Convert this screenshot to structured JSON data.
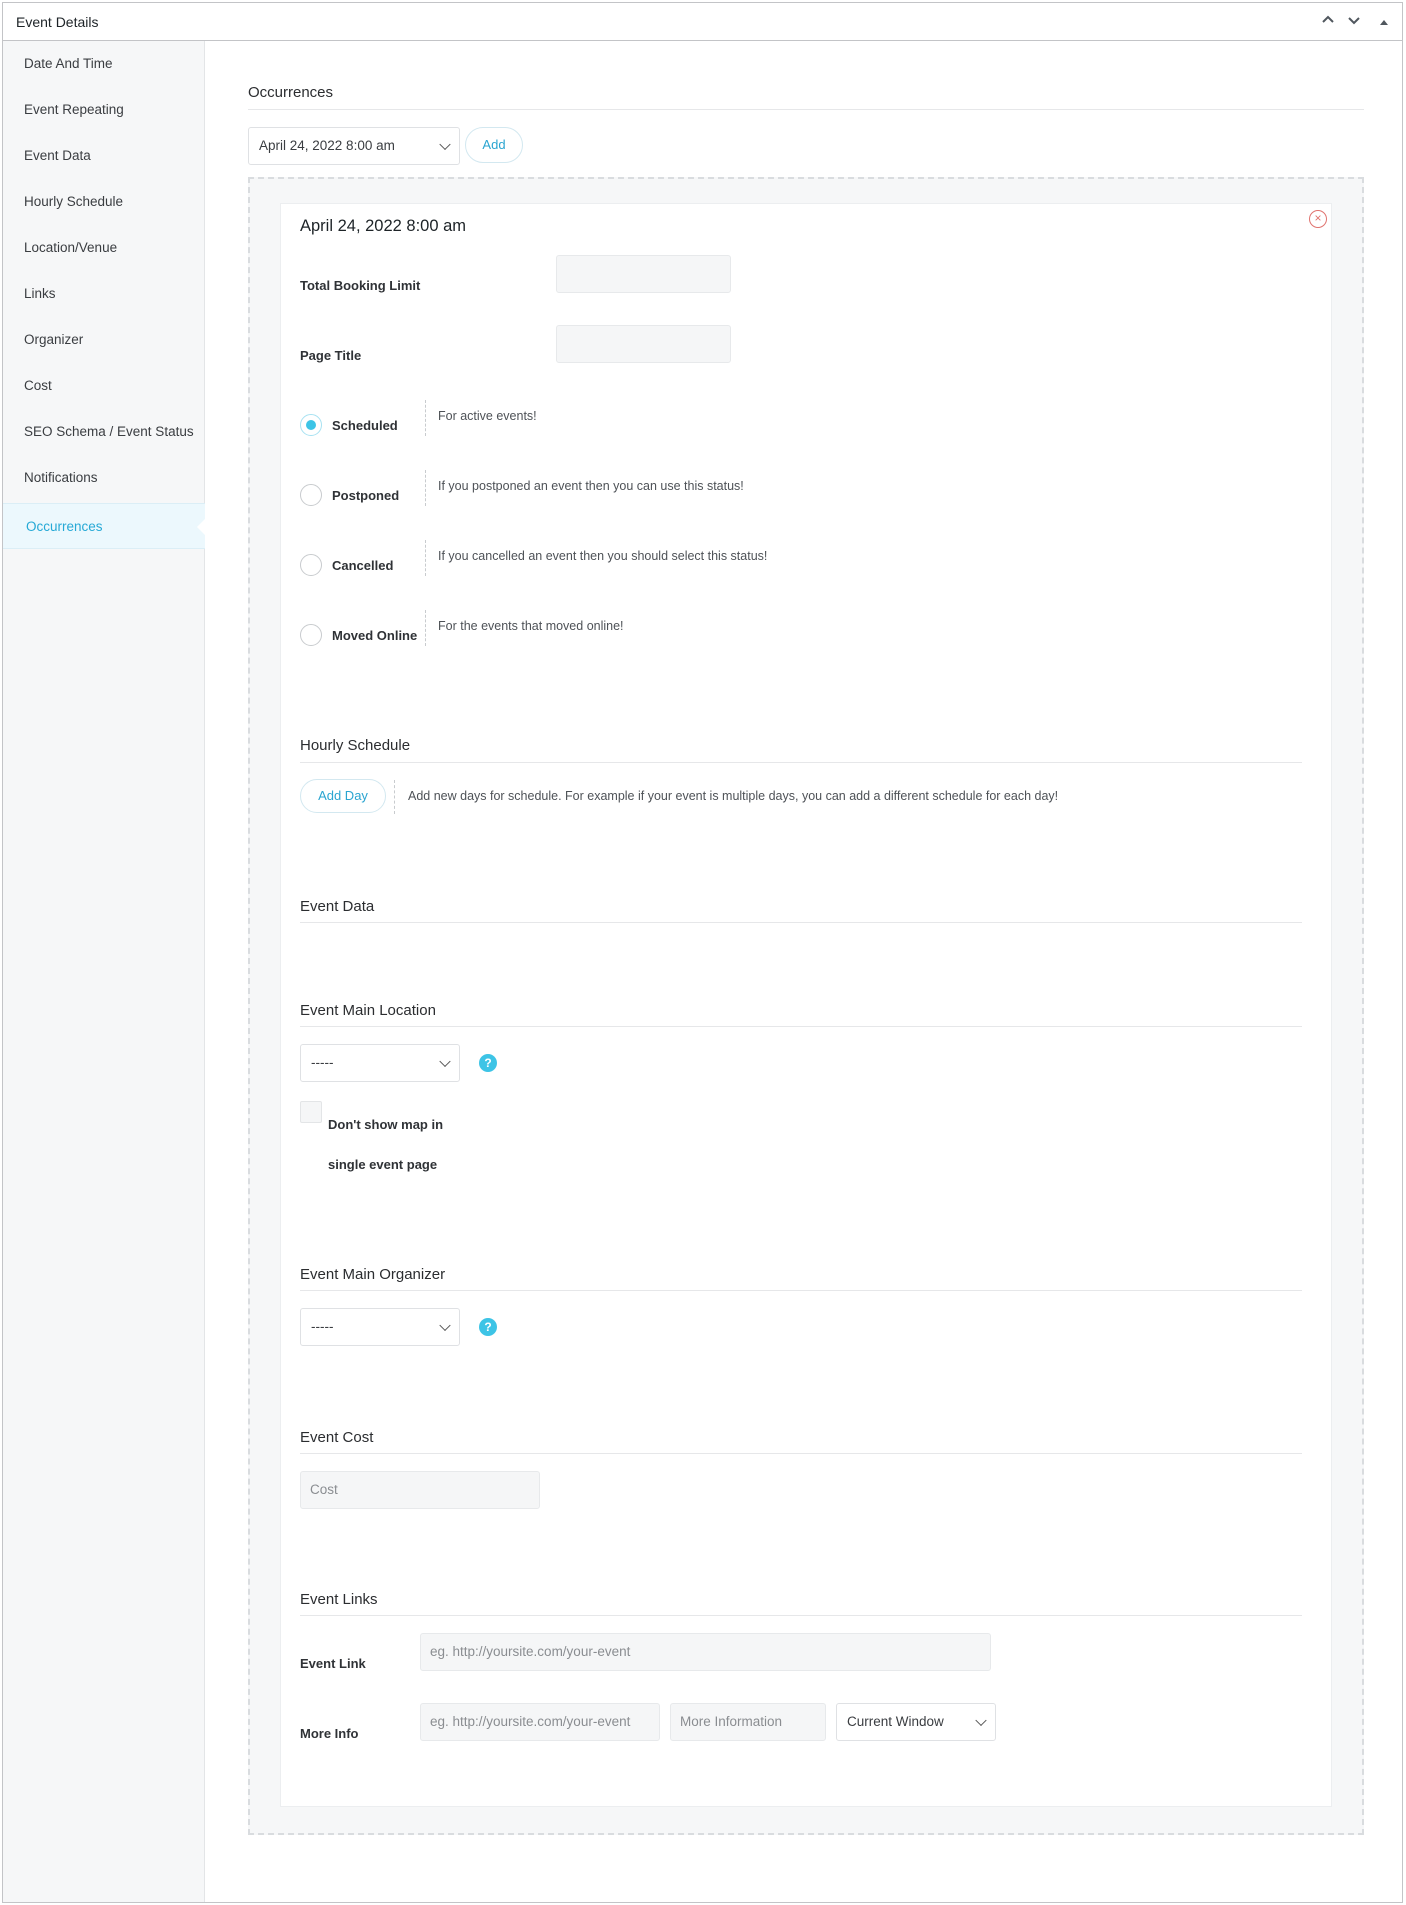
{
  "panel": {
    "title": "Event Details",
    "move_up_icon": "chevron-up-icon",
    "move_down_icon": "chevron-down-icon",
    "toggle_icon": "triangle-up-icon"
  },
  "sidebar": {
    "items": [
      {
        "label": "Date And Time"
      },
      {
        "label": "Event Repeating"
      },
      {
        "label": "Event Data"
      },
      {
        "label": "Hourly Schedule"
      },
      {
        "label": "Location/Venue"
      },
      {
        "label": "Links"
      },
      {
        "label": "Organizer"
      },
      {
        "label": "Cost"
      },
      {
        "label": "SEO Schema / Event Status"
      },
      {
        "label": "Notifications"
      },
      {
        "label": "Occurrences",
        "active": true
      }
    ]
  },
  "occurrences": {
    "heading": "Occurrences",
    "selected_date": "April 24, 2022 8:00 am",
    "add_label": "Add"
  },
  "occurrence": {
    "title": "April 24, 2022 8:00 am",
    "remove_icon": "close-circle-icon",
    "total_booking_limit_label": "Total Booking Limit",
    "total_booking_limit_value": "",
    "page_title_label": "Page Title",
    "page_title_value": "",
    "statuses": [
      {
        "label": "Scheduled",
        "desc": "For active events!",
        "checked": true
      },
      {
        "label": "Postponed",
        "desc": "If you postponed an event then you can use this status!",
        "checked": false
      },
      {
        "label": "Cancelled",
        "desc": "If you cancelled an event then you should select this status!",
        "checked": false
      },
      {
        "label": "Moved Online",
        "desc": "For the events that moved online!",
        "checked": false
      }
    ]
  },
  "hourly_schedule": {
    "heading": "Hourly Schedule",
    "add_day_label": "Add Day",
    "desc": "Add new days for schedule. For example if your event is multiple days, you can add a different schedule for each day!"
  },
  "event_data": {
    "heading": "Event Data"
  },
  "location": {
    "heading": "Event Main Location",
    "selected": "-----",
    "help_icon": "help-icon",
    "help_glyph": "?",
    "dont_show_map_line1": "Don't show map in",
    "dont_show_map_line2": "single event page"
  },
  "organizer": {
    "heading": "Event Main Organizer",
    "selected": "-----",
    "help_glyph": "?"
  },
  "cost": {
    "heading": "Event Cost",
    "placeholder": "Cost"
  },
  "links": {
    "heading": "Event Links",
    "event_link_label": "Event Link",
    "event_link_placeholder": "eg. http://yoursite.com/your-event",
    "more_info_label": "More Info",
    "more_info_url_placeholder": "eg. http://yoursite.com/your-event",
    "more_info_title_placeholder": "More Information",
    "target_selected": "Current Window"
  },
  "colors": {
    "accent": "#26a9d6",
    "radio_checked": "#3dc4e6",
    "remove": "#e0736f"
  }
}
